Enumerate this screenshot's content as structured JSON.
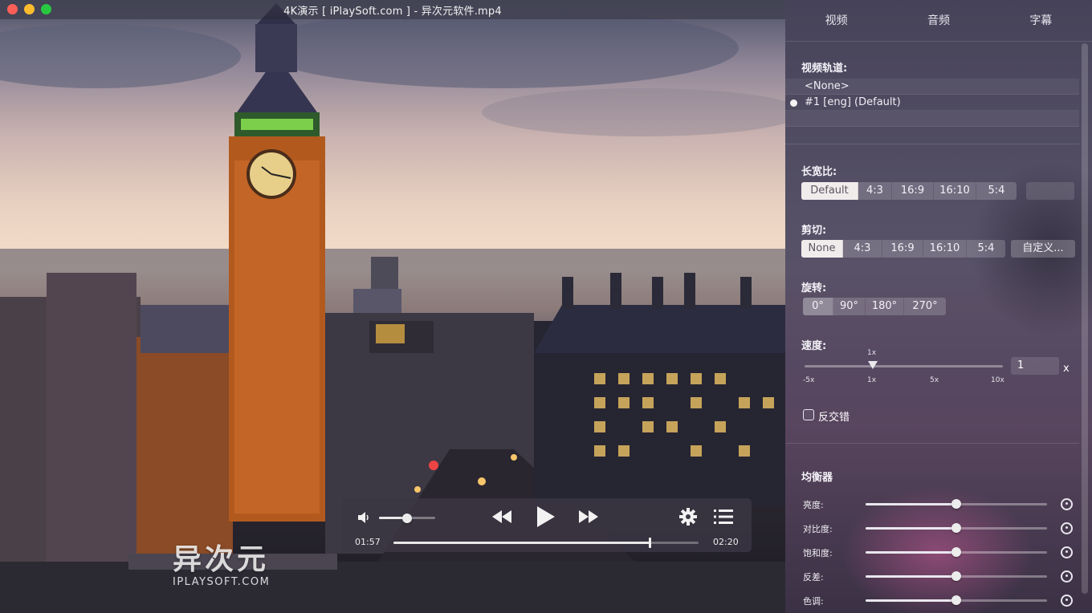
{
  "window": {
    "title": "4K演示 [ iPlaySoft.com ] - 异次元软件.mp4"
  },
  "panel": {
    "tabs": [
      "视频",
      "音频",
      "字幕"
    ],
    "video_track": {
      "label": "视频轨道:",
      "tracks": [
        "<None>",
        "#1  [eng] (Default)"
      ],
      "selected_index": 1
    },
    "aspect": {
      "label": "长宽比:",
      "options": [
        "Default",
        "4:3",
        "16:9",
        "16:10",
        "5:4"
      ],
      "selected": "Default"
    },
    "crop": {
      "label": "剪切:",
      "options": [
        "None",
        "4:3",
        "16:9",
        "16:10",
        "5:4"
      ],
      "selected": "None",
      "custom_label": "自定义..."
    },
    "rotation": {
      "label": "旋转:",
      "options": [
        "0°",
        "90°",
        "180°",
        "270°"
      ],
      "selected": "0°"
    },
    "speed": {
      "label": "速度:",
      "current_marker": "1x",
      "ticks": [
        "-5x",
        "1x",
        "5x",
        "10x"
      ],
      "value": "1",
      "unit": "x"
    },
    "deinterlace": {
      "label": "反交错",
      "checked": false
    },
    "equalizer": {
      "label": "均衡器",
      "rows": [
        {
          "label": "亮度:",
          "level": 0.5
        },
        {
          "label": "对比度:",
          "level": 0.5
        },
        {
          "label": "饱和度:",
          "level": 0.5
        },
        {
          "label": "反差:",
          "level": 0.5
        },
        {
          "label": "色调:",
          "level": 0.5
        }
      ]
    }
  },
  "controls": {
    "elapsed": "01:57",
    "total": "02:20",
    "progress": 0.84,
    "volume": 0.5,
    "icons": [
      "volume-icon",
      "rewind-icon",
      "play-icon",
      "fast-forward-icon",
      "settings-gear-icon",
      "playlist-icon"
    ]
  },
  "watermark": {
    "cn": "异次元",
    "en": "IPLAYSOFT.COM"
  }
}
